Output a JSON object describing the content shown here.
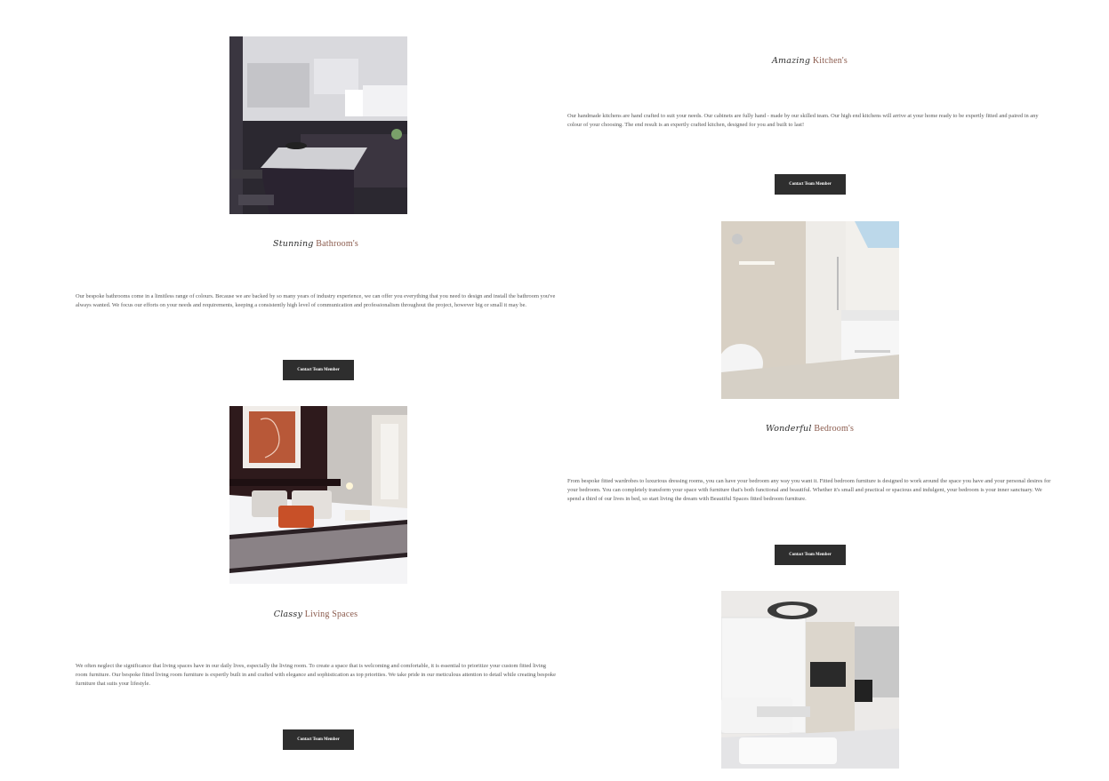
{
  "sections": {
    "kitchen": {
      "script_word": "Amazing",
      "word": "Kitchen's",
      "image_alt": "Modern kitchen with island",
      "text": "Our handmade kitchens are hand crafted to suit your needs. Our cabinets are fully hand - made by our skilled team. Our high end kitchens will arrive at your home ready to be expertly fitted and paired in any colour of your choosing. The end result is an expertly crafted kitchen, designed for you and built to last!",
      "button": "Contact Team Member"
    },
    "bathroom": {
      "script_word": "Stunning",
      "word": "Bathroom's",
      "image_alt": "Bright modern bathroom",
      "text": "Our bespoke bathrooms come in a limitless range of colours. Because we are backed by so many years of industry experience, we can offer you everything that you need to design and install the bathroom you've always wanted. We focus our efforts on your needs and requirements, keeping a consistently high level of communication and professionalism throughout the project, however big or small it may be.",
      "button": "Contact Team Member"
    },
    "bedroom": {
      "script_word": "Wonderful",
      "word": "Bedroom's",
      "image_alt": "Hotel style bedroom",
      "text": "From bespoke fitted wardrobes to luxurious dressing rooms, you can have your bedroom any way you want it. Fitted bedroom furniture is designed to work around the space you have and your personal desires for your bedroom. You can completely transform your space with furniture that's both functional and beautiful. Whether it's small and practical or spacious and indulgent, your bedroom is your inner sanctuary. We spend a third of our lives in bed, so start living the dream with Beautiful Spaces fitted bedroom furniture.",
      "button": "Contact Team Member"
    },
    "living": {
      "script_word": "Classy",
      "word": "Living Spaces",
      "image_alt": "White modern living room",
      "text": "We often neglect the significance that living spaces have in our daily lives, especially the living room. To create a space that is welcoming and comfortable, it is essential to prioritize your custom fitted living room furniture. Our bespoke fitted living room furniture is expertly built in and crafted with elegance and sophistication as top priorities. We take pride in our meticulous attention to detail while creating bespoke furniture that suits your lifestyle.",
      "button": "Contact Team Member"
    }
  }
}
